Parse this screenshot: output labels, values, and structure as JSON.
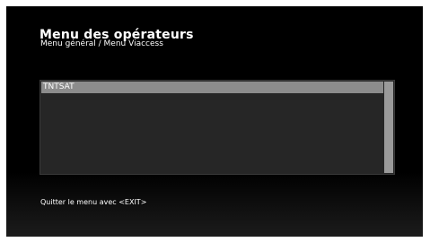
{
  "header": {
    "title": "Menu des opérateurs",
    "breadcrumb": "Menu général / Menu Viaccess"
  },
  "operators": {
    "items": [
      {
        "label": "TNTSAT",
        "selected": true
      }
    ]
  },
  "footer": {
    "hint": "Quitter le menu avec <EXIT>"
  },
  "colors": {
    "background": "#000000",
    "panel": "#262626",
    "selection": "#8c8c8c",
    "text": "#ffffff"
  }
}
